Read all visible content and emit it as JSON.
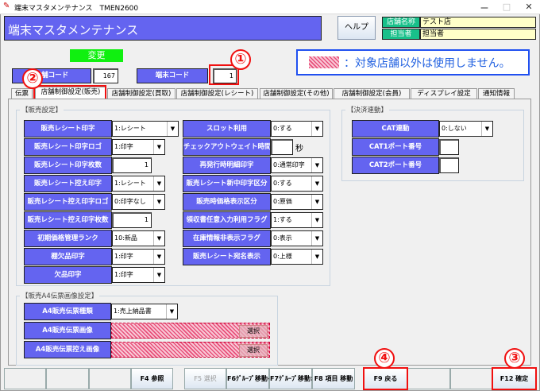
{
  "window": {
    "title": "端末マスタメンテナンス　TMEN2600",
    "controls": [
      "ー",
      "□",
      "✕"
    ]
  },
  "header": {
    "title": "端末マスタメンテナンス",
    "help_label": "ヘルプ",
    "store_name_label": "店舗名称",
    "store_name": "テスト店",
    "staff_label": "担当者",
    "staff": "担当者"
  },
  "mode": "変更",
  "store_code": {
    "label": "店舗コード",
    "value": "167"
  },
  "terminal_code": {
    "label": "端末コード",
    "value": "1"
  },
  "notice": "：対象店舗以外は使用しません。",
  "callouts": [
    "①",
    "②",
    "③",
    "④"
  ],
  "tabs": [
    "伝票",
    "店舗制御設定(販売)",
    "店舗制御設定(買取)",
    "店舗制御設定(レシート)",
    "店舗制御設定(その他)",
    "店舗制御設定(会員)",
    "ディスプレイ設定",
    "通知情報"
  ],
  "active_tab": 1,
  "sales": {
    "title": "【販売設定】",
    "left": [
      {
        "label": "販売レシート印字",
        "type": "combo",
        "value": "1:レシート"
      },
      {
        "label": "販売レシート印字ロゴ",
        "type": "combo",
        "value": "1:印字"
      },
      {
        "label": "販売レシート印字枚数",
        "type": "number",
        "value": "1"
      },
      {
        "label": "販売レシート控え印字",
        "type": "combo",
        "value": "1:レシート"
      },
      {
        "label": "販売レシート控え印字ロゴ",
        "type": "combo",
        "value": "0:印字なし"
      },
      {
        "label": "販売レシート控え印字枚数",
        "type": "number",
        "value": "1"
      },
      {
        "label": "初期価格管理ランク",
        "type": "combo",
        "value": "10:新品"
      },
      {
        "label": "棚欠品印字",
        "type": "combo",
        "value": "1:印字"
      },
      {
        "label": "欠品印字",
        "type": "combo",
        "value": "1:印字"
      }
    ],
    "right": [
      {
        "label": "スロット利用",
        "type": "combo",
        "value": "0:する"
      },
      {
        "label": "チェックアウトウェイト時間",
        "type": "seconds",
        "value": "",
        "unit": "秒"
      },
      {
        "label": "再発行時明細印字",
        "type": "combo",
        "value": "0:通常印字"
      },
      {
        "label": "販売レシート新中印字区分",
        "type": "combo",
        "value": "0:する"
      },
      {
        "label": "販売時価格表示区分",
        "type": "combo",
        "value": "0:原価"
      },
      {
        "label": "領収書任意入力利用フラグ",
        "type": "combo",
        "value": "1:する"
      },
      {
        "label": "在庫情報非表示フラグ",
        "type": "combo",
        "value": "0:表示"
      },
      {
        "label": "販売レシート宛名表示",
        "type": "combo",
        "value": "0:上様"
      }
    ]
  },
  "payment": {
    "title": "【決済連動】",
    "rows": [
      {
        "label": "CAT連動",
        "type": "combo",
        "value": "0:しない"
      },
      {
        "label": "CAT1ポート番号",
        "type": "box",
        "value": ""
      },
      {
        "label": "CAT2ポート番号",
        "type": "box",
        "value": ""
      }
    ]
  },
  "a4": {
    "title": "【販売A4伝票画像設定】",
    "rows": [
      {
        "label": "A4販売伝票種類",
        "type": "combo",
        "value": "1:売上納品書"
      },
      {
        "label": "A4販売伝票画像",
        "type": "file",
        "value": "",
        "button": "選択"
      },
      {
        "label": "A4販売伝票控え画像",
        "type": "file",
        "value": "",
        "button": "選択"
      }
    ]
  },
  "fkeys": [
    "",
    "",
    "",
    "F4 参照",
    "F5 選択",
    "F6ｸﾞﾙｰﾌﾟ移動<<",
    "F7ｸﾞﾙｰﾌﾟ移動>>",
    "F8 項目 移動",
    "F9 戻る",
    "",
    "",
    "F12 確定"
  ],
  "colors": {
    "label_bg": "#6464f0",
    "accent_green": "#10f010",
    "callout_red": "#f01010",
    "hatch": "#e8507a"
  }
}
